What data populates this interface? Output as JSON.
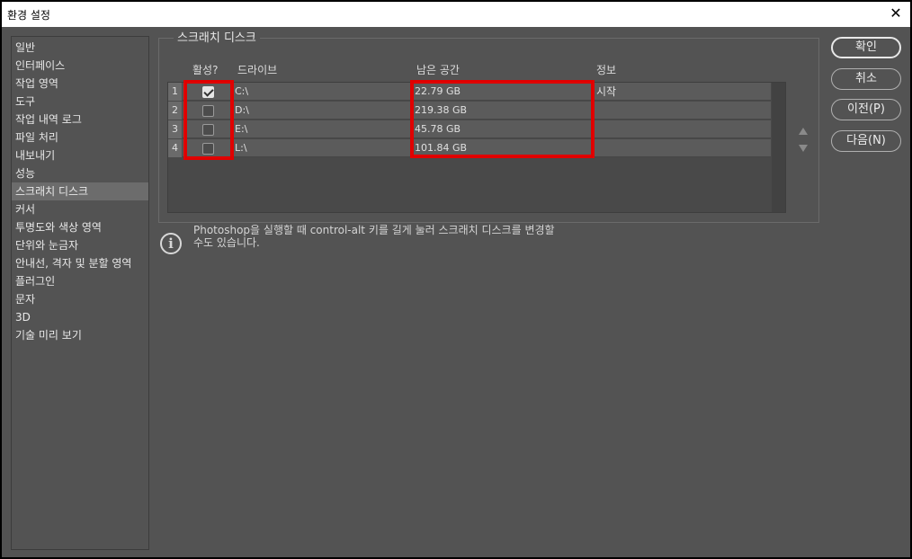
{
  "window": {
    "title": "환경 설정",
    "close_glyph": "✕"
  },
  "sidebar": {
    "items": [
      "일반",
      "인터페이스",
      "작업 영역",
      "도구",
      "작업 내역 로그",
      "파일 처리",
      "내보내기",
      "성능",
      "스크래치 디스크",
      "커서",
      "투명도와 색상 영역",
      "단위와 눈금자",
      "안내선, 격자 및 분할 영역",
      "플러그인",
      "문자",
      "3D",
      "기술 미리 보기"
    ],
    "active_index": 8
  },
  "scratch": {
    "group_label": "스크래치 디스크",
    "headers": {
      "active": "활성?",
      "drive": "드라이브",
      "space": "남은 공간",
      "info": "정보"
    },
    "rows": [
      {
        "num": "1",
        "checked": true,
        "drive": "C:\\",
        "space": "22.79 GB",
        "info": "시작"
      },
      {
        "num": "2",
        "checked": false,
        "drive": "D:\\",
        "space": "219.38 GB",
        "info": ""
      },
      {
        "num": "3",
        "checked": false,
        "drive": "E:\\",
        "space": "45.78 GB",
        "info": ""
      },
      {
        "num": "4",
        "checked": false,
        "drive": "L:\\",
        "space": "101.84 GB",
        "info": ""
      }
    ]
  },
  "info": {
    "icon": "info-icon",
    "glyph": "i",
    "text_line1": "Photoshop을 실행할 때 control-alt 키를 길게 눌러 스크래치 디스크를 변경할",
    "text_line2": "수도 있습니다."
  },
  "buttons": {
    "ok": "확인",
    "cancel": "취소",
    "prev": "이전(P)",
    "next": "다음(N)"
  },
  "colors": {
    "background": "#535353",
    "highlight": "#e00000",
    "titlebar": "#ffffff"
  }
}
